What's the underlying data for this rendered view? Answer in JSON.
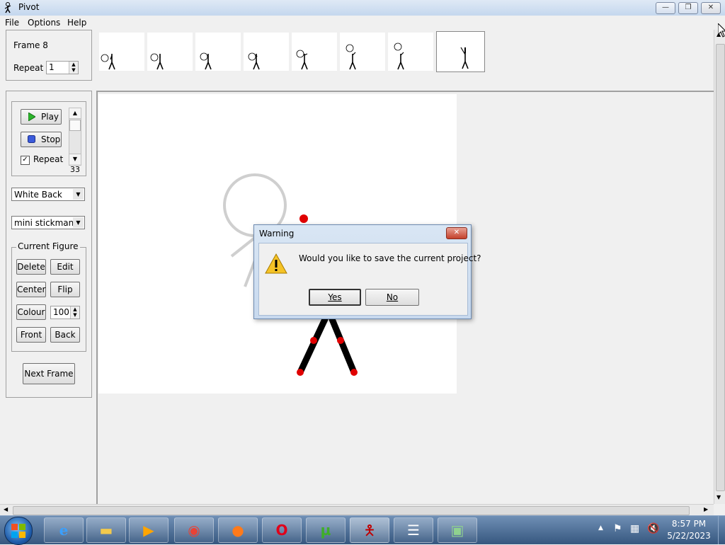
{
  "window": {
    "title": "Pivot"
  },
  "menu": {
    "items": [
      "File",
      "Options",
      "Help"
    ]
  },
  "frame_panel": {
    "label": "Frame 8",
    "repeat_label": "Repeat :",
    "repeat_value": "1"
  },
  "playback": {
    "play_label": "Play",
    "stop_label": "Stop",
    "repeat_check_label": "Repeat",
    "speed_value": "33"
  },
  "background_select": {
    "value": "White Back"
  },
  "figure_select": {
    "value": "mini stickman"
  },
  "current_figure": {
    "title": "Current Figure",
    "delete_label": "Delete",
    "edit_label": "Edit",
    "center_label": "Center",
    "flip_label": "Flip",
    "colour_label": "Colour",
    "colour_value": "100",
    "front_label": "Front",
    "back_label": "Back"
  },
  "next_frame_label": "Next Frame",
  "timeline": {
    "frame_count": 8,
    "selected_index": 7
  },
  "dialog": {
    "title": "Warning",
    "message": "Would you like to save the current project?",
    "yes_label": "Yes",
    "no_label": "No",
    "icon": "warning-icon"
  },
  "taskbar": {
    "apps": [
      "internet-explorer-icon",
      "file-explorer-icon",
      "media-player-icon",
      "chrome-icon",
      "firefox-icon",
      "opera-icon",
      "utorrent-icon",
      "pivot-icon",
      "task-list-icon",
      "system-monitor-icon"
    ],
    "time": "8:57 PM",
    "date": "5/22/2023"
  },
  "colors": {
    "joint_red": "#e00000",
    "dialog_accent": "#c8d9ee",
    "taskbar": "#4a6b92"
  }
}
